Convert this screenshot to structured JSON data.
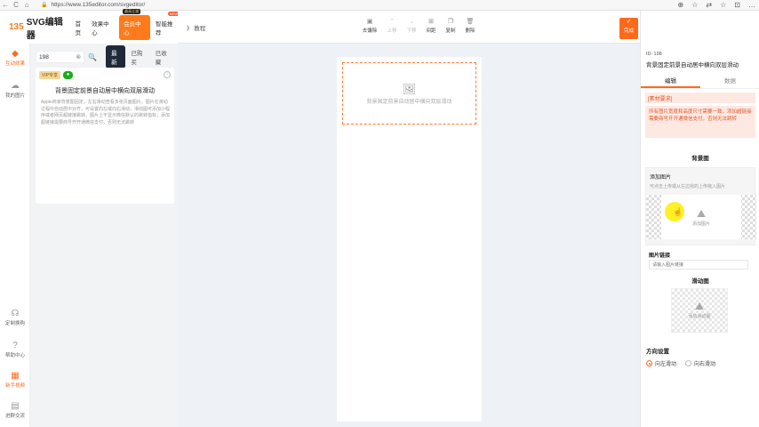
{
  "browser": {
    "url": "https://www.135editor.com/svgeditor/",
    "nav_back": "←",
    "nav_reload": "C",
    "nav_home": "⌂",
    "lock": "🔒",
    "right_icons": [
      "⊕",
      "☆",
      "⇄",
      "☆",
      "⊡",
      "…"
    ]
  },
  "header": {
    "logo_mark": "135",
    "logo_text": "SVG编辑器",
    "nav": [
      "首页",
      "效果中心"
    ],
    "vip_label": "会员中心",
    "vip_badge": "最高立减",
    "recommend_label": "智能推荐",
    "new_badge": "NEW"
  },
  "left_rail": {
    "items": [
      {
        "icon": "◆",
        "label": "互动效果"
      },
      {
        "icon": "☁",
        "label": "我的图片"
      },
      {
        "icon": "☊",
        "label": "定制换购"
      },
      {
        "icon": "?",
        "label": "帮助中心"
      },
      {
        "icon": "▦",
        "label": "新手视频"
      },
      {
        "icon": "▤",
        "label": "进群交流"
      }
    ]
  },
  "panel": {
    "search_value": "198",
    "clear_icon": "⊗",
    "search_icon": "🔍",
    "filters": [
      "最新",
      "已购买",
      "已收藏"
    ],
    "card": {
      "vip_tag": "VIP专享",
      "wechat_tag": "●",
      "info": "i",
      "title": "背景固定前景自动居中横向双层滑动",
      "desc": "Apple商家背景图固定，左右滑动查看多张页面图片，图片在滑动过程中自动居中对齐，可设置向左或向右滑动，滑动图可添加小程序或者网页超链接跳转，图片上不显示微信默认的跳转指标；添加超链接需要商号开开通微信支付，否则无法跳转"
    }
  },
  "toolbar": {
    "tutorial": "》 教程",
    "tools": [
      {
        "icon": "▣",
        "label": "去馕除",
        "disabled": false
      },
      {
        "icon": "⌃",
        "label": "上移",
        "disabled": true
      },
      {
        "icon": "⌄",
        "label": "下移",
        "disabled": true
      },
      {
        "icon": "⊞",
        "label": "间距",
        "disabled": false
      },
      {
        "icon": "❐",
        "label": "复制",
        "disabled": false
      },
      {
        "icon": "🗑",
        "label": "删除",
        "disabled": false
      }
    ],
    "done_icon": "✓",
    "done_label": "完成"
  },
  "canvas": {
    "placeholder_icon": "🖼",
    "placeholder_text": "背景固定前景自动居中横向双层滑动"
  },
  "right_panel": {
    "id_text": "ID: 198",
    "title": "背景固定前景自动居中横向双层滑动",
    "tabs": [
      "编辑",
      "数据"
    ],
    "req_title": "[素材要求]",
    "req_text": "所有图片宽度和高度尺寸需要一致，添加超链接需要商号开开通微信支付，否则无法跳转",
    "bg_section": "背景图",
    "add_img_title": "添加图片",
    "add_img_tip": "可点击上传或从左边找的上传拖入图片",
    "add_img_label": "添加图片",
    "img_icon": "⛰",
    "link_label": "图片链接",
    "link_placeholder": "请输入图片链接",
    "slide_section": "滑动图",
    "slide_label": "添加滑动图",
    "direction_title": "方向设置",
    "directions": [
      {
        "label": "向左滑动",
        "checked": true
      },
      {
        "label": "向右滑动",
        "checked": false
      }
    ],
    "cursor": "☝"
  }
}
